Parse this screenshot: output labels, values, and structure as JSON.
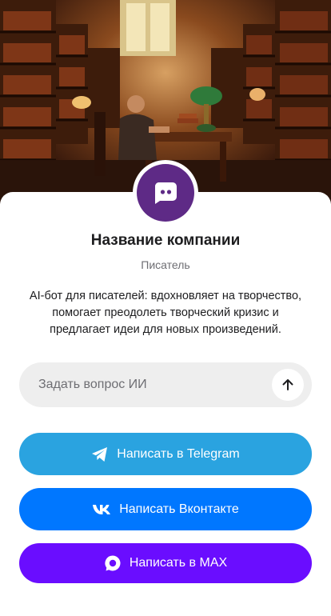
{
  "company": {
    "name": "Название компании",
    "role": "Писатель",
    "description_lines": [
      "AI-бот для писателей: вдохновляет на творчество,",
      "помогает преодолеть творческий кризис и",
      "предлагает идеи для новых произведений."
    ]
  },
  "icons": {
    "avatar": "chat-bot-icon",
    "send": "arrow-up-icon",
    "telegram": "telegram-icon",
    "vk": "vk-icon",
    "max": "max-icon"
  },
  "ask": {
    "placeholder": "Задать вопрос ИИ"
  },
  "buttons": {
    "telegram": "Написать в Telegram",
    "vk": "Написать Вконтакте",
    "max": "Написать в MAX"
  },
  "colors": {
    "avatar": "#5e2a86",
    "telegram": "#2aa3e0",
    "vk": "#0077ff",
    "max": "#6a0dff"
  }
}
